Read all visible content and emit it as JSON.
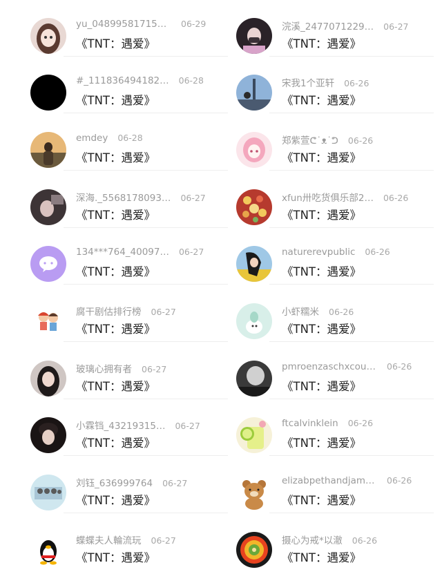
{
  "left_column": [
    {
      "username": "yu_048995817154…",
      "date": "06-29",
      "title": "《TNT：遇爱》",
      "avatar_icon": "anime-girl-avatar"
    },
    {
      "username": "#_111836494182…",
      "date": "06-28",
      "title": "《TNT：遇爱》",
      "avatar_icon": "black-circle-avatar"
    },
    {
      "username": "emdey",
      "date": "06-28",
      "title": "《TNT：遇爱》",
      "avatar_icon": "sunset-person-avatar"
    },
    {
      "username": "深海._5568178093…",
      "date": "06-27",
      "title": "《TNT：遇爱》",
      "avatar_icon": "dark-photo-avatar"
    },
    {
      "username": "134***764_40097…",
      "date": "06-27",
      "title": "《TNT：遇爱》",
      "avatar_icon": "purple-chat-avatar"
    },
    {
      "username": "腐干剧估排行榜",
      "date": "06-27",
      "title": "《TNT：遇爱》",
      "avatar_icon": "cartoon-couple-avatar"
    },
    {
      "username": "玻璃心拥有者",
      "date": "06-27",
      "title": "《TNT：遇爱》",
      "avatar_icon": "girl-portrait-avatar"
    },
    {
      "username": "小霖铛_43219315…",
      "date": "06-27",
      "title": "《TNT：遇爱》",
      "avatar_icon": "boy-portrait-avatar"
    },
    {
      "username": "刘钰_636999764",
      "date": "06-27",
      "title": "《TNT：遇爱》",
      "avatar_icon": "group-photo-avatar"
    },
    {
      "username": "蝶蝶夫人輪流玩",
      "date": "06-27",
      "title": "《TNT：遇爱》",
      "avatar_icon": "qq-penguin-avatar"
    }
  ],
  "right_column": [
    {
      "username": "浣溪_2477071229…",
      "date": "06-27",
      "title": "《TNT：遇爱》",
      "avatar_icon": "masked-girl-avatar"
    },
    {
      "username": "宋我1个亚轩",
      "date": "06-26",
      "title": "《TNT：遇爱》",
      "avatar_icon": "city-tower-avatar"
    },
    {
      "username": "郑紫萱ᕦ˙ᴥ˙ᕤ",
      "date": "06-26",
      "title": "《TNT：遇爱》",
      "avatar_icon": "pink-anime-avatar"
    },
    {
      "username": "xfun卅吃货俱乐部2…",
      "date": "06-26",
      "title": "《TNT：遇爱》",
      "avatar_icon": "food-dish-avatar"
    },
    {
      "username": "naturerevpublic",
      "date": "06-26",
      "title": "《TNT：遇爱》",
      "avatar_icon": "illustrated-girl-avatar"
    },
    {
      "username": "小虾糯米",
      "date": "06-26",
      "title": "《TNT：遇爱》",
      "avatar_icon": "mint-cartoon-avatar"
    },
    {
      "username": "pmroenzaschxcoul…",
      "date": "06-26",
      "title": "《TNT：遇爱》",
      "avatar_icon": "bw-face-avatar"
    },
    {
      "username": "ftcalvinklein",
      "date": "06-26",
      "title": "《TNT：遇爱》",
      "avatar_icon": "lemon-drink-avatar"
    },
    {
      "username": "elizabpethandjamh…",
      "date": "06-26",
      "title": "《TNT：遇爱》",
      "avatar_icon": "teddy-bear-avatar"
    },
    {
      "username": "摄心为戒*以澈",
      "date": "06-26",
      "title": "《TNT：遇爱》",
      "avatar_icon": "sunflower-avatar"
    }
  ],
  "colors": {
    "text_primary": "#222222",
    "text_secondary": "#9a9a9a",
    "divider": "#eeeeee",
    "purple_avatar": "#b99cf2"
  }
}
